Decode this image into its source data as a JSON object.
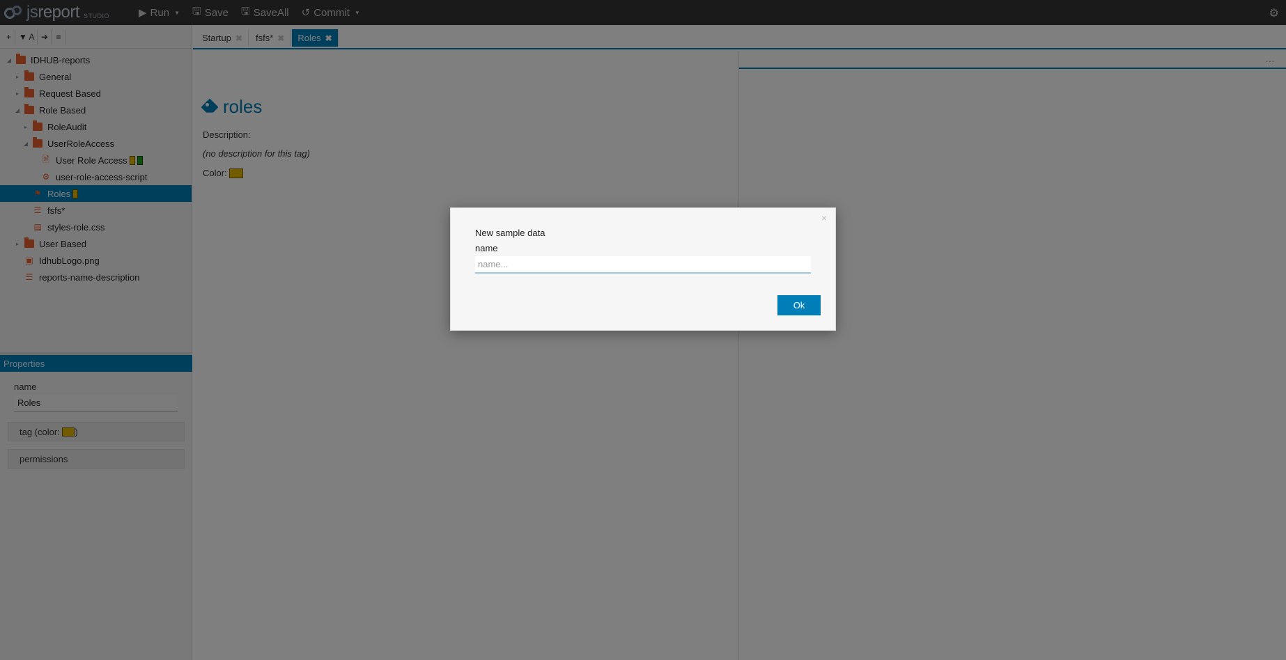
{
  "app": {
    "logo_js": "js",
    "logo_report": "report",
    "logo_studio": "STUDIO"
  },
  "toolbar": {
    "run_label": "Run",
    "save_label": "Save",
    "saveall_label": "SaveAll",
    "commit_label": "Commit"
  },
  "tree_toolbar": {
    "add": "+",
    "filter": "▼ A",
    "arrow": "➔",
    "menu": "≡"
  },
  "tree": {
    "root": "IDHUB-reports",
    "items": [
      {
        "label": "General"
      },
      {
        "label": "Request Based"
      },
      {
        "label": "Role Based"
      },
      {
        "label": "RoleAudit"
      },
      {
        "label": "UserRoleAccess"
      },
      {
        "label": "User Role Access"
      },
      {
        "label": "user-role-access-script"
      },
      {
        "label": "Roles"
      },
      {
        "label": "fsfs*"
      },
      {
        "label": "styles-role.css"
      },
      {
        "label": "User Based"
      },
      {
        "label": "IdhubLogo.png"
      },
      {
        "label": "reports-name-description"
      }
    ]
  },
  "properties": {
    "header": "Properties",
    "name_label": "name",
    "name_value": "Roles",
    "tag_section_prefix": "tag (color:",
    "tag_section_suffix": ")",
    "permissions_label": "permissions"
  },
  "tabs": [
    {
      "label": "Startup"
    },
    {
      "label": "fsfs*"
    },
    {
      "label": "Roles"
    }
  ],
  "editor": {
    "title": "roles",
    "description_label": "Description:",
    "description_value": "(no description for this tag)",
    "color_label": "Color:"
  },
  "preview": {
    "menu": "..."
  },
  "modal": {
    "close": "×",
    "title": "New sample data",
    "name_label": "name",
    "name_placeholder": "name...",
    "name_value": "",
    "ok_label": "Ok"
  },
  "colors": {
    "accent": "#007eb8",
    "toolbar_bg": "#353535",
    "folder": "#e8602c",
    "tag_yellow": "#e6b800",
    "tag_green": "#1a9c1a"
  }
}
